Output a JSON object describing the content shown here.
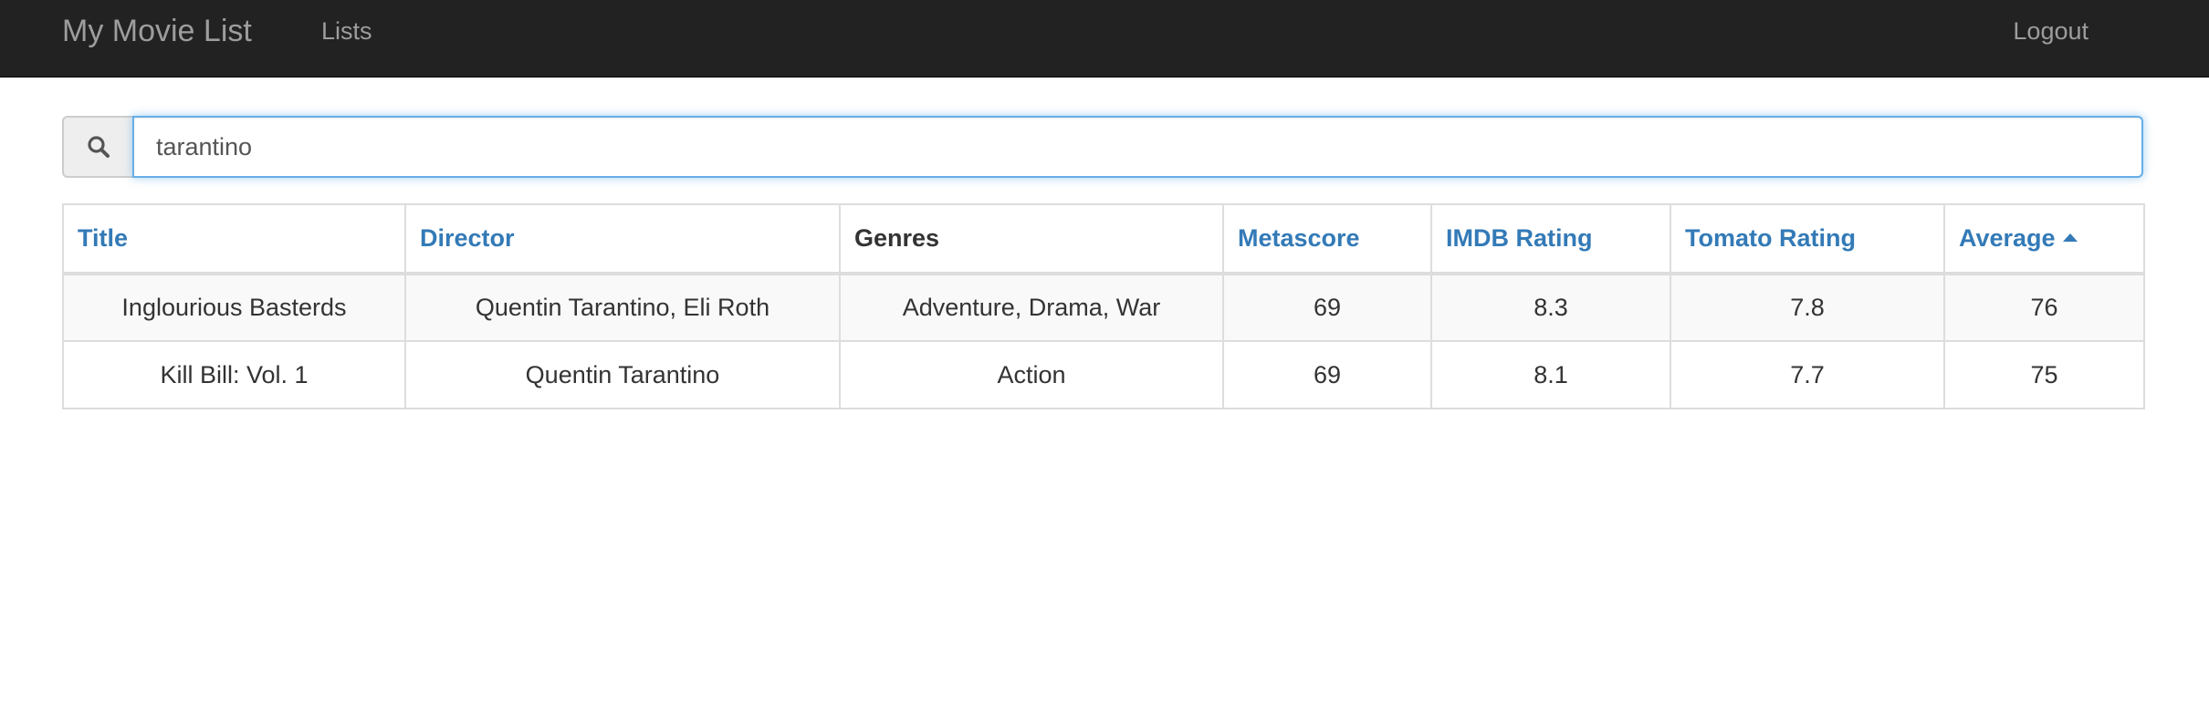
{
  "navbar": {
    "brand": "My Movie List",
    "lists_label": "Lists",
    "logout_label": "Logout"
  },
  "search": {
    "icon": "search-icon",
    "value": "tarantino"
  },
  "table": {
    "headers": {
      "title": "Title",
      "director": "Director",
      "genres": "Genres",
      "metascore": "Metascore",
      "imdb": "IMDB Rating",
      "tomato": "Tomato Rating",
      "average": "Average"
    },
    "sorted_by": "average",
    "sort_direction": "ascending",
    "rows": [
      {
        "title": "Inglourious Basterds",
        "director": "Quentin Tarantino, Eli Roth",
        "genres": "Adventure, Drama, War",
        "metascore": "69",
        "imdb": "8.3",
        "tomato": "7.8",
        "average": "76"
      },
      {
        "title": "Kill Bill: Vol. 1",
        "director": "Quentin Tarantino",
        "genres": "Action",
        "metascore": "69",
        "imdb": "8.1",
        "tomato": "7.7",
        "average": "75"
      }
    ]
  },
  "colors": {
    "navbar_bg": "#222222",
    "nav_text": "#9d9d9d",
    "link": "#337ab7",
    "focus_border": "#66afe9"
  }
}
